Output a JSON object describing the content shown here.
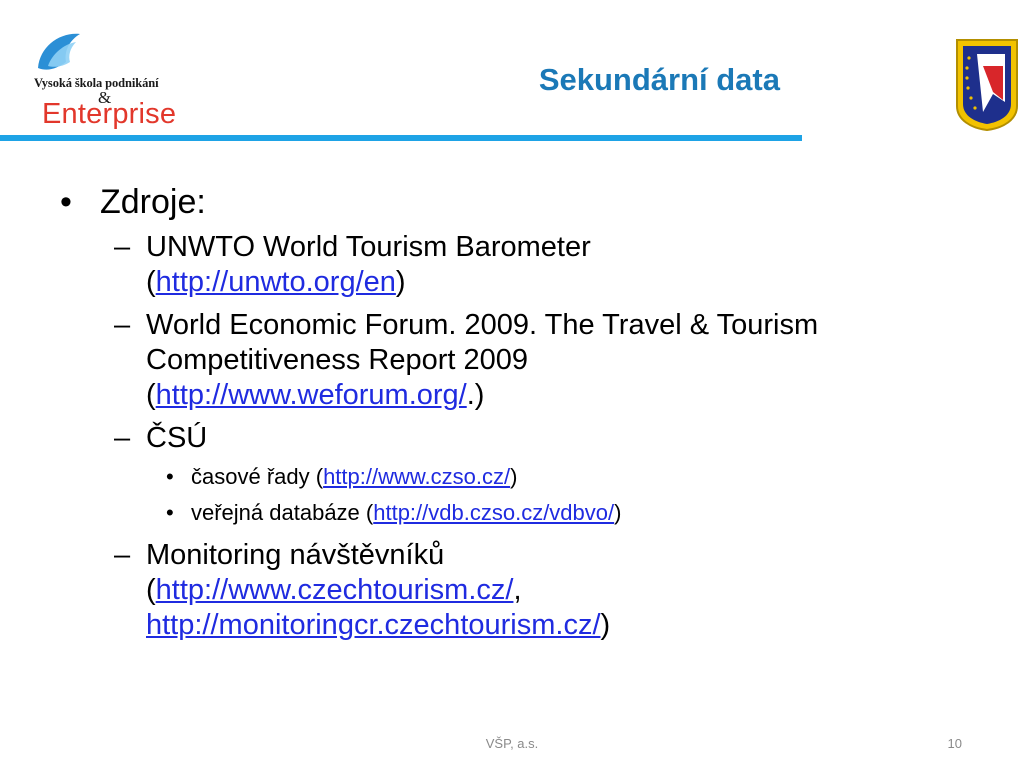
{
  "header": {
    "logo": {
      "school_name": "Vysoká škola podnikání",
      "ampersand": "&",
      "brand": "Enterprise"
    },
    "title": "Sekundární data",
    "badge_icon": "euroregion-praded-emblem"
  },
  "content": {
    "heading": "Zdroje:",
    "items": [
      {
        "text": "UNWTO World Tourism Barometer",
        "open": "(",
        "link": "http://unwto.org/en",
        "close": ")"
      },
      {
        "line1": "World Economic Forum. 2009. The Travel & Tourism",
        "line2": "Competitiveness Report 2009",
        "open": "(",
        "link": "http://www.weforum.org/",
        "close": ".)"
      },
      {
        "text": "ČSÚ",
        "sub": [
          {
            "text": "časové řady (",
            "link": "http://www.czso.cz/",
            "close": ")"
          },
          {
            "text": "veřejná databáze (",
            "link": "http://vdb.czso.cz/vdbvo/",
            "close": ")"
          }
        ]
      },
      {
        "text": "Monitoring návštěvníků",
        "open": "(",
        "link1": "http://www.czechtourism.cz/",
        "sep": ",",
        "link2": "http://monitoringcr.czechtourism.cz/",
        "close": ")"
      }
    ]
  },
  "footer": {
    "center": "VŠP, a.s.",
    "page": "10"
  },
  "colors": {
    "title": "#1b79b7",
    "rule": "#1ea3e6",
    "link": "#1f2be0",
    "logo_red": "#e2372b"
  }
}
